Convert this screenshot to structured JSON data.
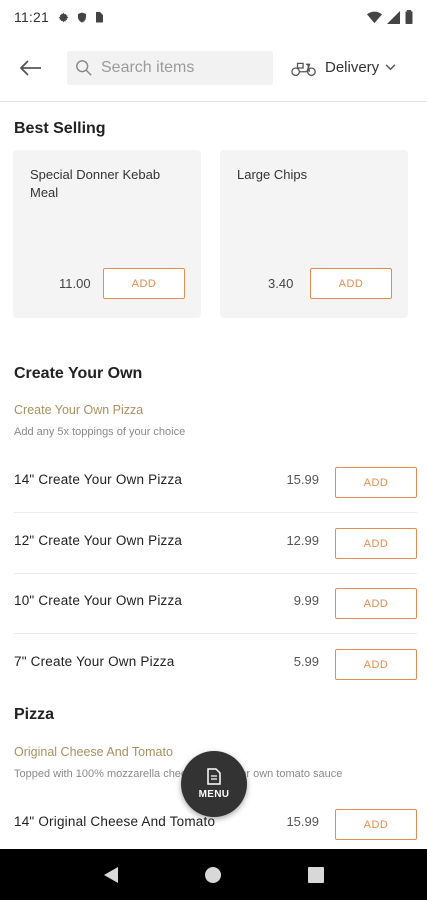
{
  "status_bar": {
    "time": "11:21"
  },
  "header": {
    "search_placeholder": "Search items",
    "delivery_label": "Delivery"
  },
  "best_selling": {
    "title": "Best Selling",
    "items": [
      {
        "name": "Special Donner Kebab Meal",
        "price": "11.00",
        "add_label": "ADD"
      },
      {
        "name": "Large Chips",
        "price": "3.40",
        "add_label": "ADD"
      }
    ]
  },
  "create_your_own": {
    "title": "Create Your Own",
    "subcategory": "Create Your Own Pizza",
    "description": "Add any 5x toppings of your choice",
    "items": [
      {
        "name": "14\" Create Your Own Pizza",
        "price": "15.99",
        "add_label": "ADD"
      },
      {
        "name": "12\" Create Your Own Pizza",
        "price": "12.99",
        "add_label": "ADD"
      },
      {
        "name": "10\" Create Your Own Pizza",
        "price": "9.99",
        "add_label": "ADD"
      },
      {
        "name": "7\" Create Your Own Pizza",
        "price": "5.99",
        "add_label": "ADD"
      }
    ]
  },
  "pizza": {
    "title": "Pizza",
    "subcategory": "Original Cheese And Tomato",
    "description": "Topped with 100% mozzarella cheese and Mixor own tomato sauce",
    "items": [
      {
        "name": "14\" Original Cheese And Tomato",
        "price": "15.99",
        "add_label": "ADD"
      }
    ]
  },
  "menu_fab": {
    "label": "MENU"
  },
  "colors": {
    "accent": "#e38d52",
    "subcategory": "#a9905e",
    "card_bg": "#f4f4f4",
    "fab_bg": "#333333"
  }
}
